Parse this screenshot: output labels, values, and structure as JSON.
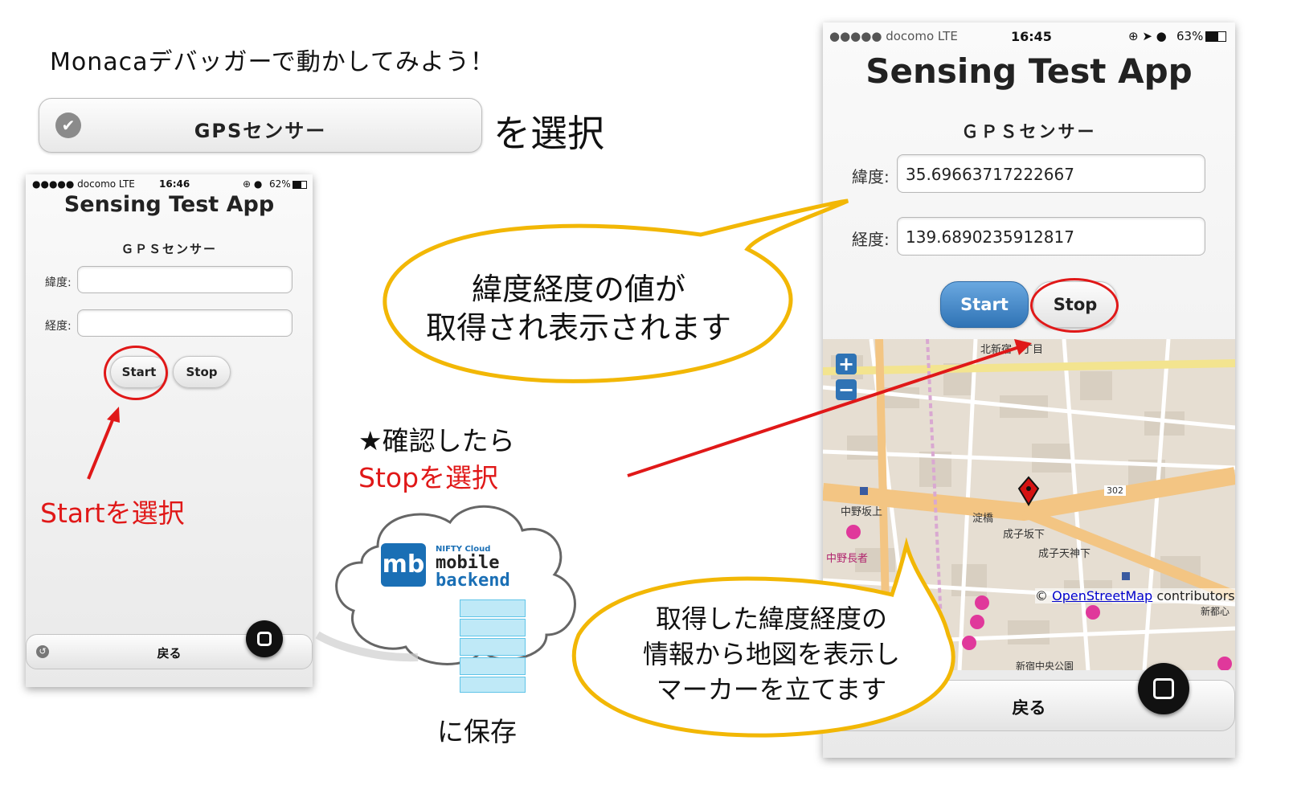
{
  "headline": "Monacaデバッガーで動かしてみよう！",
  "sensor_bar": {
    "label": "GPSセンサー",
    "check_icon": "check-circle-icon"
  },
  "select_text": "を選択",
  "left_phone": {
    "status": {
      "carrier": "●●●●● docomo  LTE",
      "time": "16:46",
      "battery": "62%"
    },
    "title": "Sensing Test App",
    "subtitle": "ＧＰＳセンサー",
    "lat_label": "緯度:",
    "lat_value": "",
    "lng_label": "経度:",
    "lng_value": "",
    "start_label": "Start",
    "stop_label": "Stop",
    "back_label": "戻る"
  },
  "right_phone": {
    "status": {
      "carrier": "●●●●● docomo  LTE",
      "time": "16:45",
      "battery": "63%"
    },
    "title": "Sensing Test App",
    "subtitle": "ＧＰＳセンサー",
    "lat_label": "緯度:",
    "lat_value": "35.69663717222667",
    "lng_label": "経度:",
    "lng_value": "139.6890235912817",
    "start_label": "Start",
    "stop_label": "Stop",
    "back_label": "戻る",
    "map": {
      "zoom_in": "+",
      "zoom_out": "−",
      "attribution_prefix": "©",
      "attribution_link": "OpenStreetMap",
      "attribution_suffix": "contributors",
      "labels": [
        "北新宿一丁目",
        "中野坂上",
        "淀橋",
        "成子坂下",
        "成子天神下",
        "302",
        "中野長者",
        "新宿中央公園",
        "新都心"
      ]
    }
  },
  "annotations": {
    "start_select": "Startを選択",
    "confirm_line1": "★確認したら",
    "confirm_line2": "Stopを選択",
    "save_text": "に保存",
    "bubble_top_line1": "緯度経度の値が",
    "bubble_top_line2": "取得され表示されます",
    "bubble_bottom_line1": "取得した緯度経度の",
    "bubble_bottom_line2": "情報から地図を表示し",
    "bubble_bottom_line3": "マーカーを立てます"
  },
  "cloud": {
    "logo": "mb",
    "brand_top": "NIFTY Cloud",
    "brand_line1": "mobile",
    "brand_line2": "backend"
  },
  "colors": {
    "annotation_red": "#e01818",
    "bubble_border": "#f2b705",
    "button_blue": "#2f73b5",
    "map_road": "#f3c583"
  }
}
